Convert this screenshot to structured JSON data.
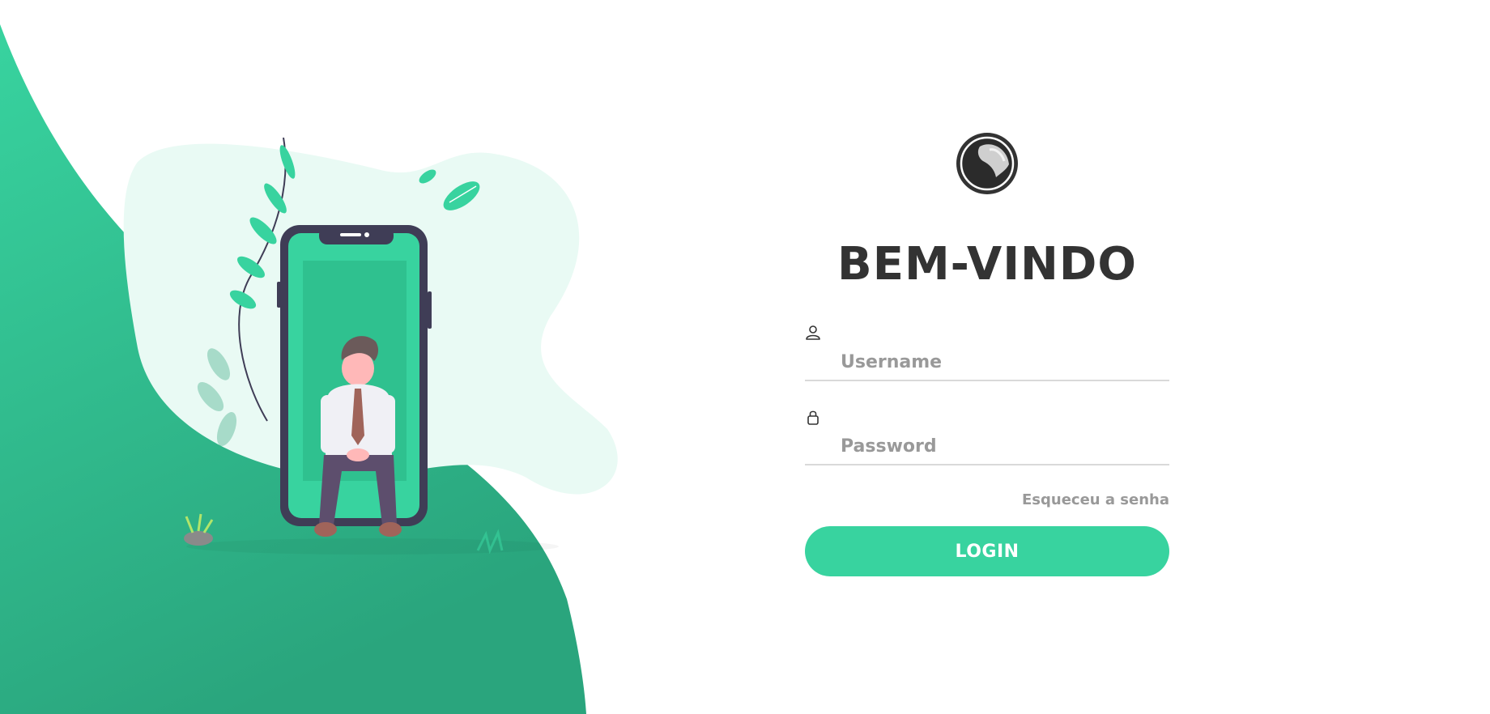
{
  "colors": {
    "accent": "#38d39f",
    "accent_dark": "#2ab683",
    "title": "#333333",
    "placeholder": "#999999",
    "phone_frame": "#3f3d56"
  },
  "illustration": {
    "icon": "person-with-phone-illustration"
  },
  "login": {
    "avatar_icon": "avatar-icon",
    "title": "BEM-VINDO",
    "username": {
      "icon": "user-icon",
      "placeholder": "Username",
      "value": ""
    },
    "password": {
      "icon": "lock-icon",
      "placeholder": "Password",
      "value": ""
    },
    "forgot_label": "Esqueceu a senha",
    "submit_label": "LOGIN"
  }
}
